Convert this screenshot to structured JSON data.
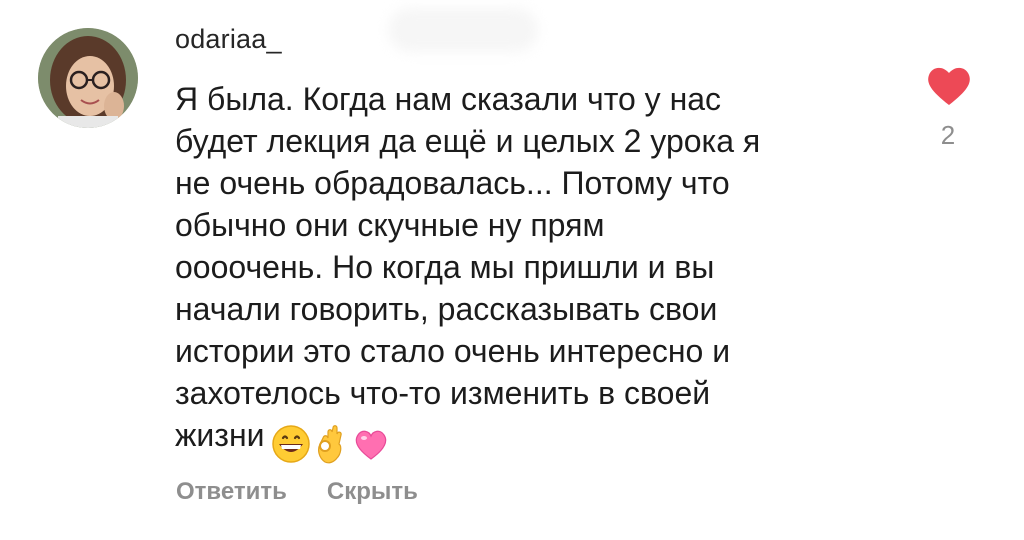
{
  "comment": {
    "username": "odariaa_",
    "text": "Я была. Когда нам сказали что у нас\nбудет лекция да ещё и целых 2 урока я\nне очень обрадовалась... Потому что\nобычно они скучные ну прям\nоооочень. Но когда мы пришли и вы\nначали говорить, рассказывать свои\nистории это стало очень интересно и\nзахотелось что-то изменить в своей\nжизни",
    "emojis": [
      "grinning-face-icon",
      "ok-hand-icon",
      "pink-heart-icon"
    ],
    "like_count": "2",
    "like_color": "#ed4956",
    "actions": {
      "reply": "Ответить",
      "hide": "Скрыть"
    }
  }
}
